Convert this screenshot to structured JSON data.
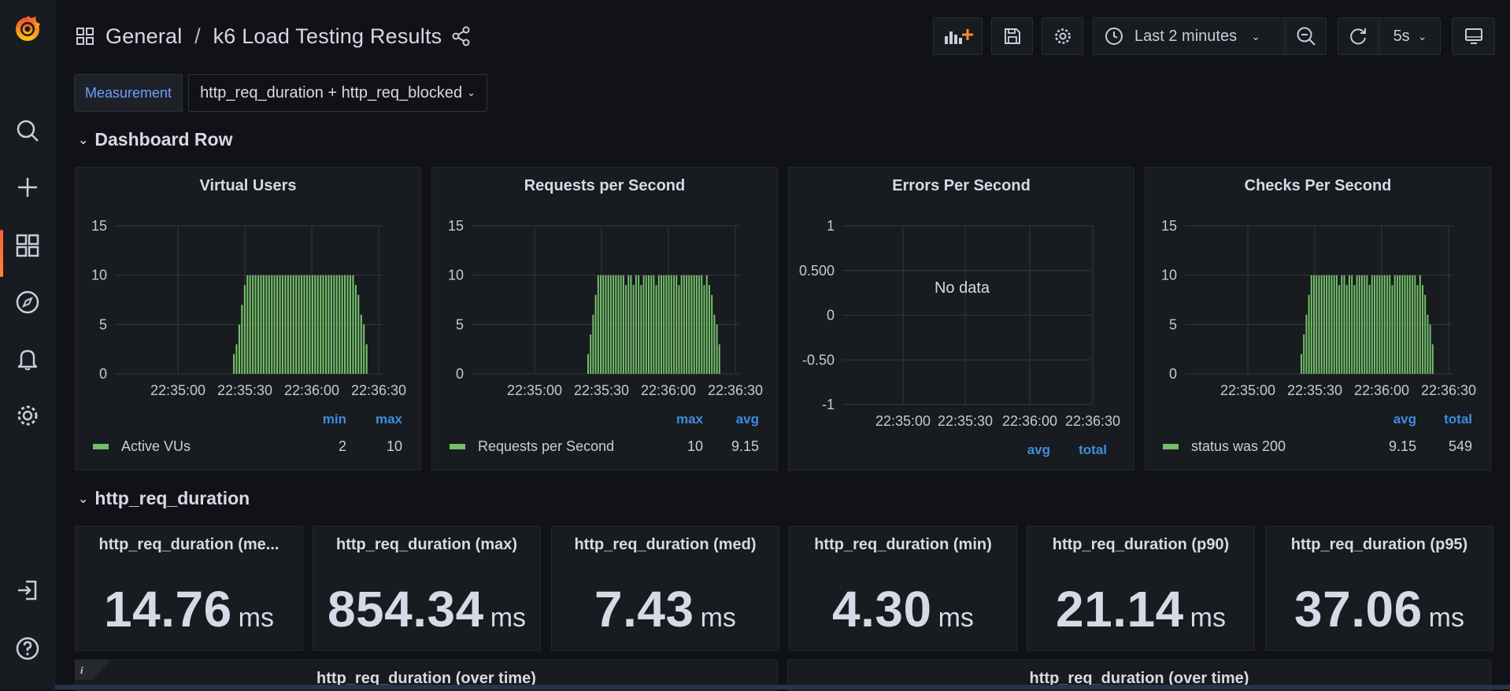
{
  "header": {
    "folder": "General",
    "separator": "/",
    "dashboard": "k6 Load Testing Results"
  },
  "toolbar": {
    "time_range": "Last 2 minutes",
    "refresh_interval": "5s"
  },
  "variables": {
    "label": "Measurement",
    "value": "http_req_duration + http_req_blocked"
  },
  "rows": [
    {
      "title": "Dashboard Row"
    },
    {
      "title": "http_req_duration"
    }
  ],
  "graph_panels": [
    {
      "title": "Virtual Users",
      "legend_headers": [
        "min",
        "max"
      ],
      "legend": {
        "name": "Active VUs",
        "values": [
          "2",
          "10"
        ]
      },
      "yticks": [
        "15",
        "10",
        "5",
        "0"
      ],
      "xticks": [
        "22:35:00",
        "22:35:30",
        "22:36:00",
        "22:36:30"
      ]
    },
    {
      "title": "Requests per Second",
      "legend_headers": [
        "max",
        "avg"
      ],
      "legend": {
        "name": "Requests per Second",
        "values": [
          "10",
          "9.15"
        ]
      },
      "yticks": [
        "15",
        "10",
        "5",
        "0"
      ],
      "xticks": [
        "22:35:00",
        "22:35:30",
        "22:36:00",
        "22:36:30"
      ]
    },
    {
      "title": "Errors Per Second",
      "legend_headers": [
        "avg",
        "total"
      ],
      "no_data": "No data",
      "yticks": [
        "1",
        "0.500",
        "0",
        "-0.50",
        "-1"
      ],
      "xticks": [
        "22:35:00",
        "22:35:30",
        "22:36:00",
        "22:36:30"
      ]
    },
    {
      "title": "Checks Per Second",
      "legend_headers": [
        "avg",
        "total"
      ],
      "legend": {
        "name": "status was 200",
        "values": [
          "9.15",
          "549"
        ]
      },
      "yticks": [
        "15",
        "10",
        "5",
        "0"
      ],
      "xticks": [
        "22:35:00",
        "22:35:30",
        "22:36:00",
        "22:36:30"
      ]
    }
  ],
  "stats": [
    {
      "title": "http_req_duration (me...",
      "value": "14.76",
      "unit": "ms"
    },
    {
      "title": "http_req_duration (max)",
      "value": "854.34",
      "unit": "ms"
    },
    {
      "title": "http_req_duration (med)",
      "value": "7.43",
      "unit": "ms"
    },
    {
      "title": "http_req_duration (min)",
      "value": "4.30",
      "unit": "ms"
    },
    {
      "title": "http_req_duration (p90)",
      "value": "21.14",
      "unit": "ms"
    },
    {
      "title": "http_req_duration (p95)",
      "value": "37.06",
      "unit": "ms"
    }
  ],
  "bottom_panels": [
    {
      "title": "http_req_duration (over time)"
    },
    {
      "title": "http_req_duration (over time)"
    }
  ],
  "chart_data": [
    {
      "type": "bar",
      "title": "Virtual Users",
      "series": [
        {
          "name": "Active VUs",
          "values": [
            2,
            3,
            5,
            7,
            9,
            10,
            10,
            10,
            10,
            10,
            10,
            10,
            10,
            10,
            10,
            10,
            10,
            10,
            10,
            10,
            10,
            10,
            10,
            10,
            10,
            10,
            10,
            10,
            10,
            10,
            10,
            10,
            10,
            10,
            10,
            10,
            10,
            10,
            10,
            10,
            10,
            10,
            10,
            10,
            10,
            9,
            8,
            6,
            5,
            3
          ]
        }
      ],
      "ylim": [
        0,
        15
      ],
      "color": "#73bf69"
    },
    {
      "type": "bar",
      "title": "Requests per Second",
      "series": [
        {
          "name": "Requests per Second",
          "values": [
            2,
            4,
            6,
            8,
            10,
            10,
            10,
            10,
            10,
            10,
            10,
            10,
            10,
            10,
            10,
            9,
            10,
            10,
            9,
            10,
            10,
            9,
            10,
            10,
            10,
            10,
            10,
            9,
            10,
            10,
            10,
            10,
            10,
            10,
            10,
            10,
            9,
            10,
            10,
            10,
            10,
            10,
            10,
            10,
            10,
            10,
            9,
            10,
            9,
            8,
            6,
            5,
            3
          ]
        }
      ],
      "ylim": [
        0,
        15
      ],
      "color": "#73bf69"
    },
    {
      "type": "bar",
      "title": "Errors Per Second",
      "series": [],
      "ylim": [
        -1,
        1
      ]
    },
    {
      "type": "bar",
      "title": "Checks Per Second",
      "series": [
        {
          "name": "status was 200",
          "values": [
            2,
            4,
            6,
            8,
            10,
            10,
            10,
            10,
            10,
            10,
            10,
            10,
            10,
            10,
            10,
            9,
            10,
            10,
            9,
            10,
            10,
            9,
            10,
            10,
            10,
            10,
            10,
            9,
            10,
            10,
            10,
            10,
            10,
            10,
            10,
            10,
            9,
            10,
            10,
            10,
            10,
            10,
            10,
            10,
            10,
            10,
            9,
            10,
            9,
            8,
            6,
            5,
            3
          ]
        }
      ],
      "ylim": [
        0,
        15
      ],
      "color": "#73bf69"
    }
  ]
}
